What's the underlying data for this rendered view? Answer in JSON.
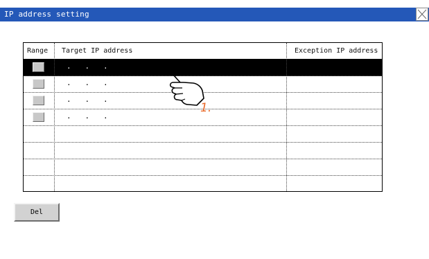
{
  "window": {
    "title": "IP address setting",
    "close_icon": "close-icon",
    "title_bar_color": "#2458b8"
  },
  "table": {
    "headers": {
      "range": "Range",
      "target": "Target IP address",
      "exception": "Exception IP address"
    },
    "rows": [
      {
        "range_checkbox": true,
        "target": ".   .   .",
        "exception": "",
        "selected": true
      },
      {
        "range_checkbox": true,
        "target": ".   .   .",
        "exception": "",
        "selected": false
      },
      {
        "range_checkbox": true,
        "target": ".   .   .",
        "exception": "",
        "selected": false
      },
      {
        "range_checkbox": true,
        "target": ".   .   .",
        "exception": "",
        "selected": false
      },
      {
        "range_checkbox": false,
        "target": "",
        "exception": "",
        "selected": false
      },
      {
        "range_checkbox": false,
        "target": "",
        "exception": "",
        "selected": false
      },
      {
        "range_checkbox": false,
        "target": "",
        "exception": "",
        "selected": false
      },
      {
        "range_checkbox": false,
        "target": "",
        "exception": "",
        "selected": false
      }
    ]
  },
  "buttons": {
    "del_label": "Del"
  },
  "annotation": {
    "pointer_icon": "pointing-hand-icon",
    "step_label": "1.",
    "step_color": "#e8692a"
  }
}
